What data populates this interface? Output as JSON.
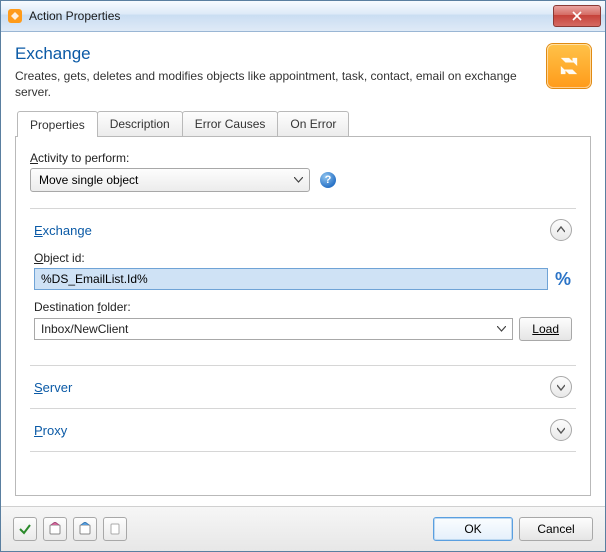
{
  "window": {
    "title": "Action Properties"
  },
  "header": {
    "title": "Exchange",
    "desc": "Creates, gets, deletes and modifies objects like appointment, task, contact, email on exchange server."
  },
  "tabs": [
    {
      "label": "Properties",
      "active": true
    },
    {
      "label": "Description",
      "active": false
    },
    {
      "label": "Error Causes",
      "active": false
    },
    {
      "label": "On Error",
      "active": false
    }
  ],
  "activity": {
    "label_pre": "A",
    "label_post": "ctivity to perform:",
    "value": "Move single object"
  },
  "panels": {
    "exchange": {
      "title_pre": "E",
      "title_post": "xchange",
      "expanded": true,
      "object_id": {
        "label_pre": "O",
        "label_post": "bject id:",
        "value": "%DS_EmailList.Id%"
      },
      "destination": {
        "label_pre": "Destination ",
        "label_u": "f",
        "label_post": "older:",
        "value": "Inbox/NewClient",
        "load_label": "Load"
      }
    },
    "server": {
      "title_pre": "S",
      "title_post": "erver",
      "expanded": false
    },
    "proxy": {
      "title_pre": "P",
      "title_post": "roxy",
      "expanded": false
    }
  },
  "footer": {
    "ok": "OK",
    "cancel": "Cancel"
  }
}
